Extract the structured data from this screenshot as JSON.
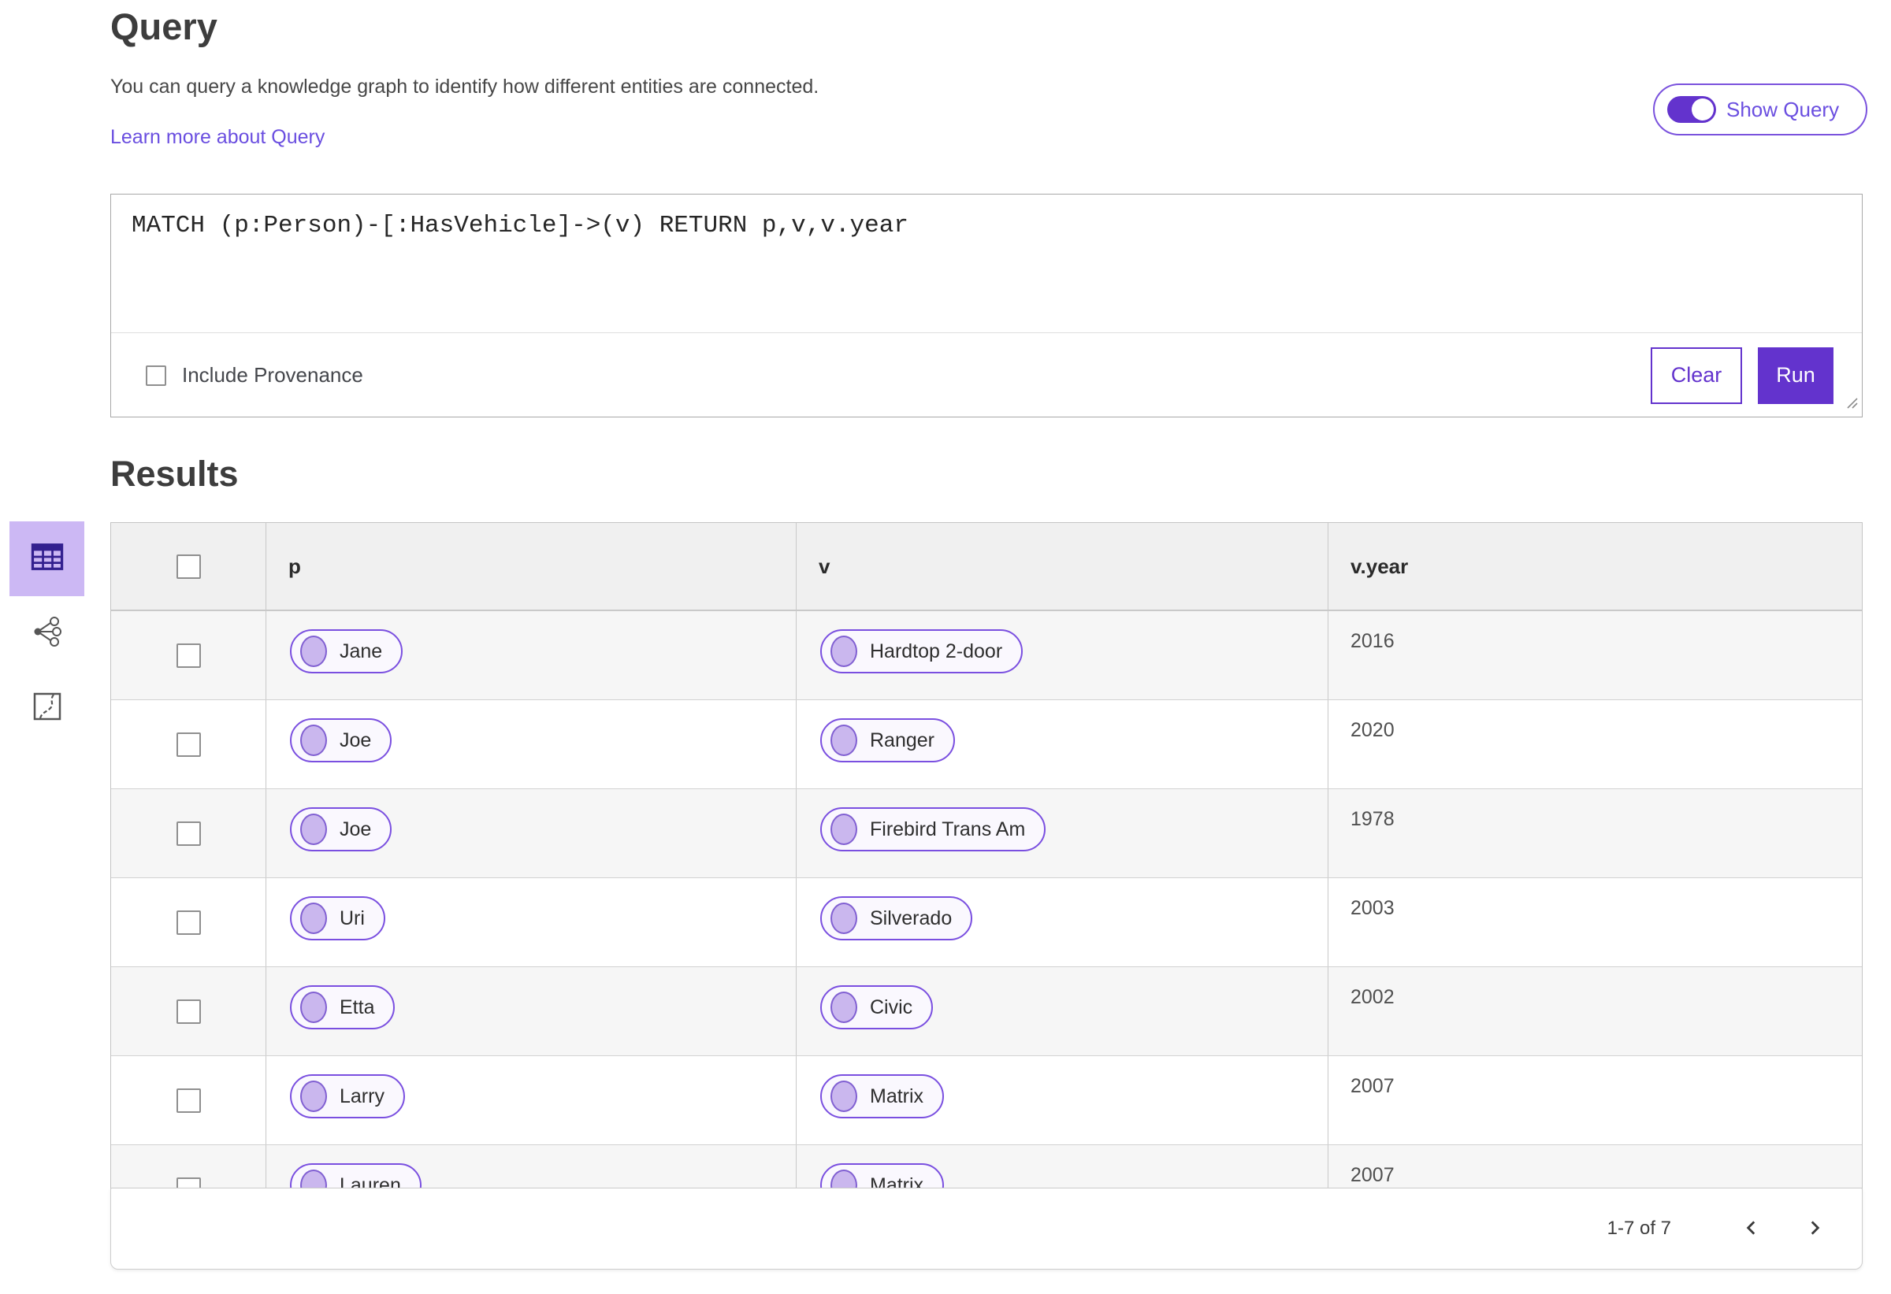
{
  "colors": {
    "accent_purple": "#6333cd",
    "link_purple": "#6a4ee0",
    "chip_border_purple": "#7a4fe0",
    "chip_circle_fill": "#cab7ee",
    "selected_view_bg": "#ccb8f4",
    "table_header_bg": "#f0f0f0",
    "row_alt_bg": "#f6f6f6"
  },
  "query": {
    "title": "Query",
    "description": "You can query a knowledge graph to identify how different entities are connected.",
    "learn_more_label": "Learn more about Query",
    "show_query_label": "Show Query",
    "show_query_on": true,
    "query_text": "MATCH (p:Person)-[:HasVehicle]->(v) RETURN p,v,v.year",
    "include_provenance_label": "Include Provenance",
    "include_provenance_checked": false,
    "clear_label": "Clear",
    "run_label": "Run"
  },
  "results": {
    "title": "Results",
    "view_switcher": {
      "selected": "table-view",
      "buttons": [
        "table-view",
        "graph-view",
        "map-view"
      ]
    },
    "table": {
      "columns": [
        "p",
        "v",
        "v.year"
      ],
      "rows": [
        {
          "p": "Jane",
          "v": "Hardtop 2-door",
          "v_year": "2016"
        },
        {
          "p": "Joe",
          "v": "Ranger",
          "v_year": "2020"
        },
        {
          "p": "Joe",
          "v": "Firebird Trans Am",
          "v_year": "1978"
        },
        {
          "p": "Uri",
          "v": "Silverado",
          "v_year": "2003"
        },
        {
          "p": "Etta",
          "v": "Civic",
          "v_year": "2002"
        },
        {
          "p": "Larry",
          "v": "Matrix",
          "v_year": "2007"
        },
        {
          "p": "Lauren",
          "v": "Matrix",
          "v_year": "2007"
        }
      ]
    },
    "pagination": {
      "range": "1-7 of 7"
    }
  }
}
